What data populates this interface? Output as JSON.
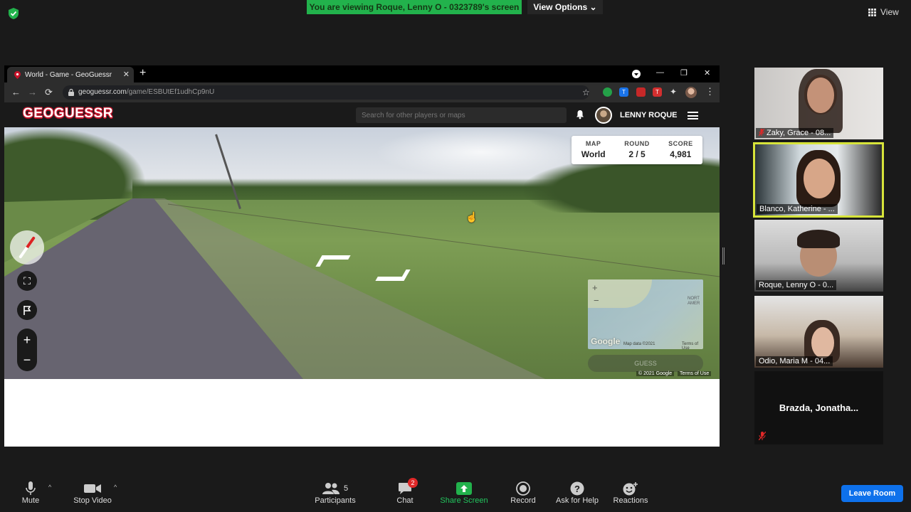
{
  "zoom": {
    "viewing_banner": "You are viewing Roque, Lenny O - 0323789's screen",
    "view_options": "View Options",
    "view_top": "View"
  },
  "browser": {
    "tab_title": "World - Game - GeoGuessr",
    "tab_close": "✕",
    "new_tab": "+",
    "url_domain": "geoguessr.com",
    "url_path": "/game/ESBUtEf1udhCp9nU",
    "extensions": [
      {
        "label": "",
        "color": "#24a148"
      },
      {
        "label": "T",
        "color": "#1a73e8"
      },
      {
        "label": "",
        "color": "#c62828"
      },
      {
        "label": "T",
        "color": "#d32f2f"
      }
    ]
  },
  "geoguessr": {
    "logo": "GEOGUESSR",
    "search_placeholder": "Search for other players or maps",
    "user_name": "LENNY ROQUE",
    "score_panel": [
      {
        "label": "MAP",
        "value": "World"
      },
      {
        "label": "ROUND",
        "value": "2 / 5"
      },
      {
        "label": "SCORE",
        "value": "4,981"
      }
    ],
    "minimap": {
      "plus": "+",
      "minus": "−",
      "google": "Google",
      "map_data": "Map data ©2021",
      "terms": "Terms of Use",
      "label": "NORT AMER"
    },
    "guess_button": "GUESS",
    "sv_copyright": "© 2021 Google",
    "sv_terms": "Terms of Use"
  },
  "participants": [
    {
      "name": "Zaky, Grace - 08...",
      "muted": true
    },
    {
      "name": "Blanco, Katherine - ...",
      "muted": false
    },
    {
      "name": "Roque, Lenny O - 0...",
      "muted": false
    },
    {
      "name": "Odio, Maria M - 04...",
      "muted": false
    },
    {
      "name": "Brazda,  Jonatha...",
      "muted": true
    }
  ],
  "toolbar": {
    "mute": "Mute",
    "stop_video": "Stop Video",
    "participants": "Participants",
    "participants_count": "5",
    "chat": "Chat",
    "chat_badge": "2",
    "share_screen": "Share Screen",
    "record": "Record",
    "ask_for_help": "Ask for Help",
    "reactions": "Reactions",
    "leave_room": "Leave Room"
  },
  "colors": {
    "banner_green": "#22b24c",
    "active_speaker": "#d7e43a",
    "leave_blue": "#0e71eb",
    "share_green": "#22b24c",
    "geoguessr_red": "#c9122a"
  }
}
